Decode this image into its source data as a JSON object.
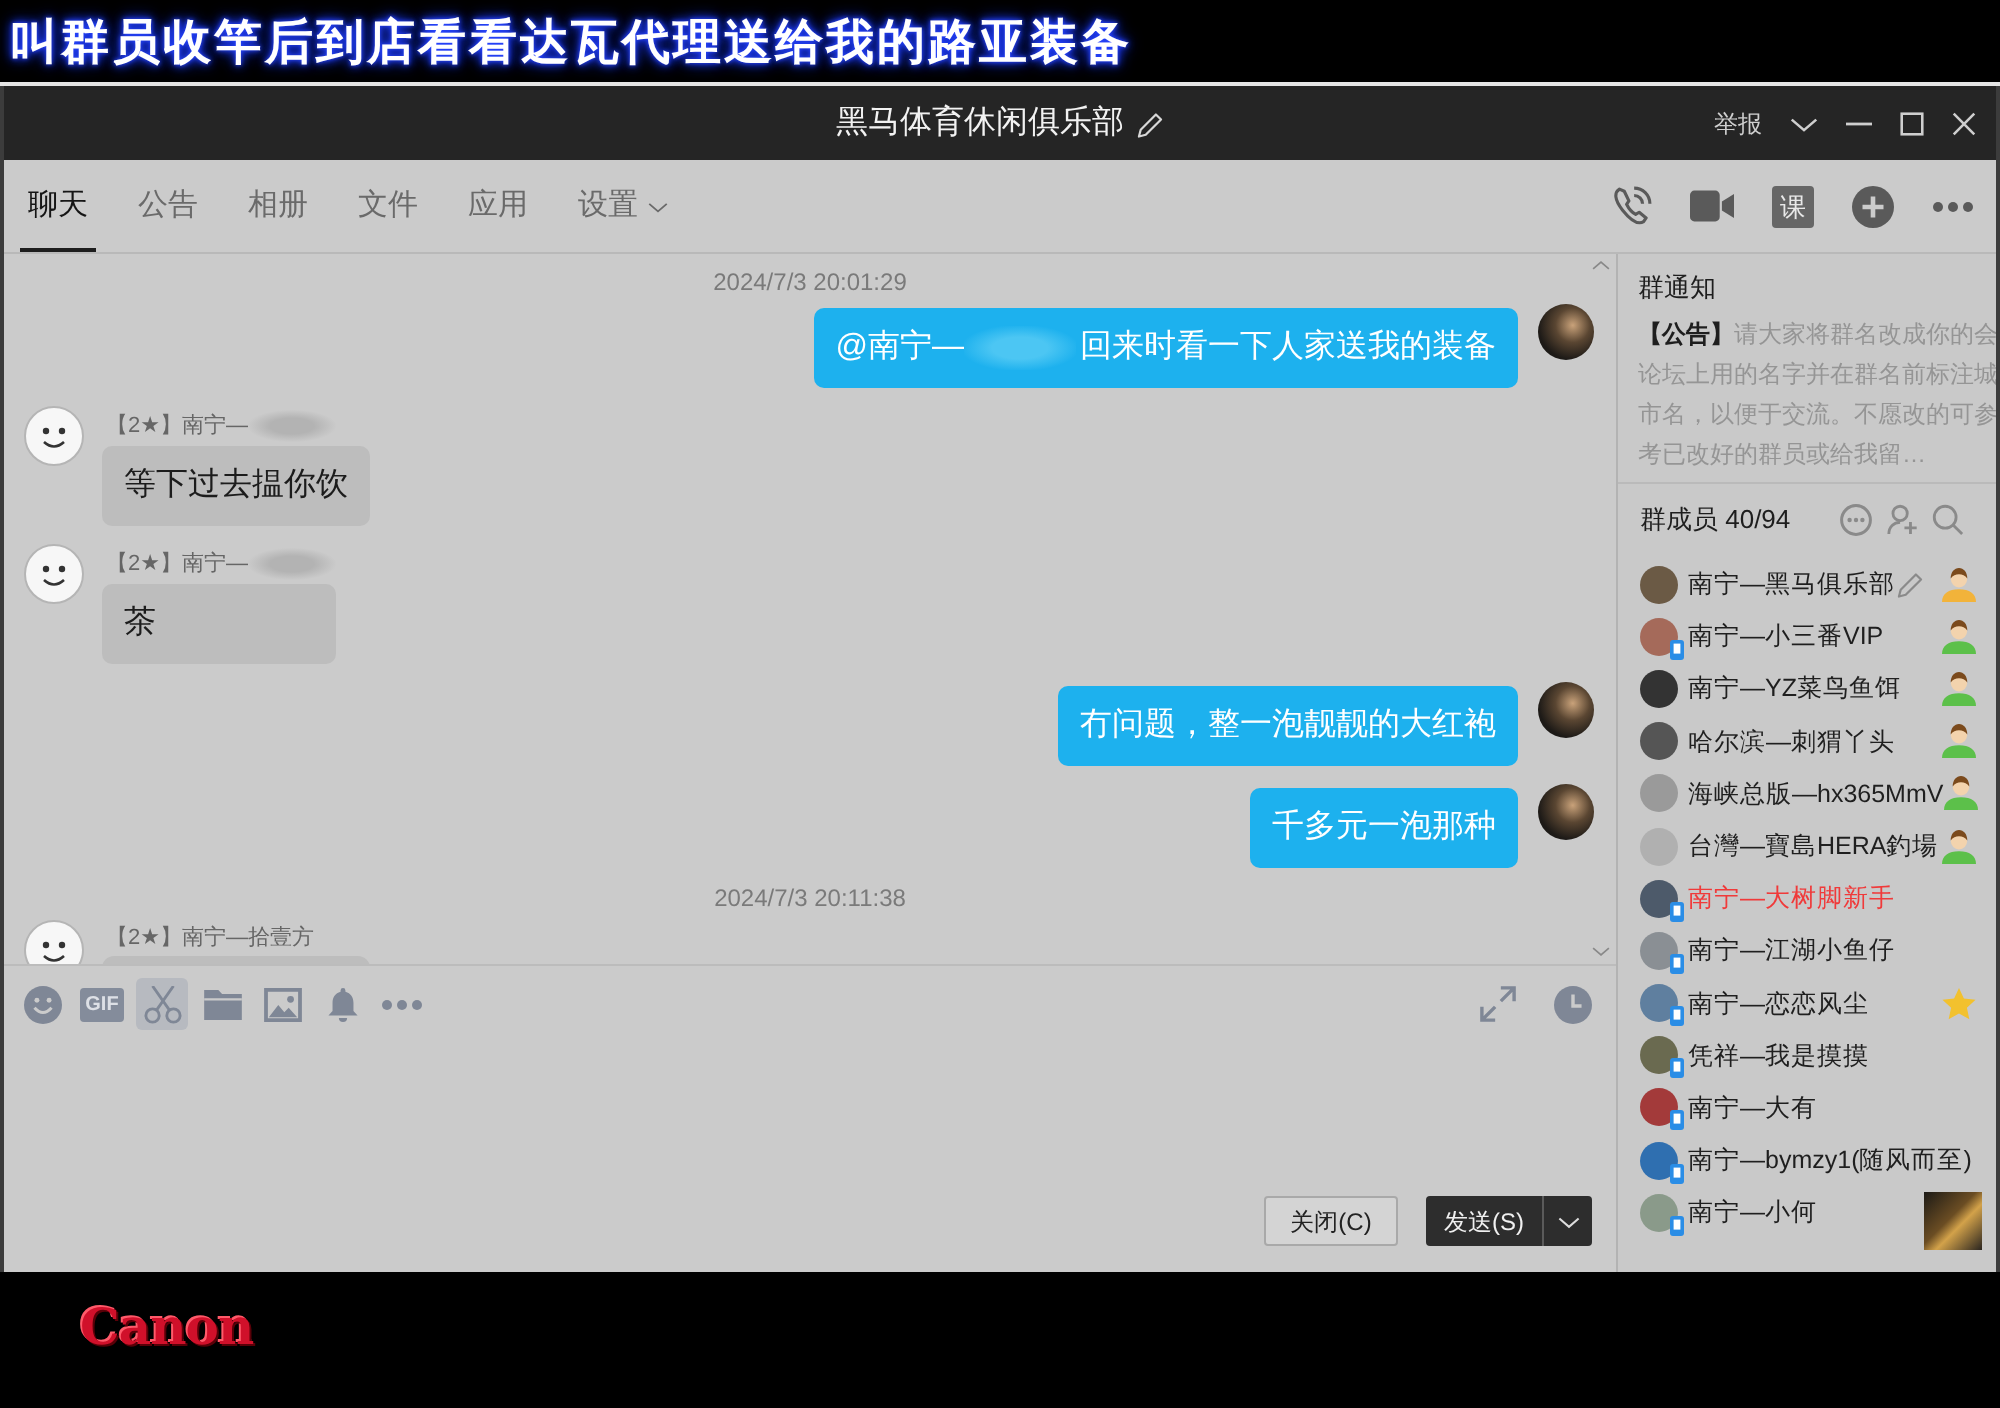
{
  "caption": {
    "text": "叫群员收竿后到店看看达瓦代理送给我的路亚装备"
  },
  "window": {
    "title": "黑马体育休闲俱乐部",
    "report": "举报"
  },
  "tabs": [
    {
      "label": "聊天",
      "kind": "page",
      "selected": true
    },
    {
      "label": "公告",
      "kind": "page",
      "selected": false
    },
    {
      "label": "相册",
      "kind": "page",
      "selected": false
    },
    {
      "label": "文件",
      "kind": "page",
      "selected": false
    },
    {
      "label": "应用",
      "kind": "page",
      "selected": false
    },
    {
      "label": "设置",
      "kind": "menu",
      "selected": false
    }
  ],
  "header_tools": [
    {
      "kind": "voice-call"
    },
    {
      "kind": "video-call"
    },
    {
      "kind": "course",
      "label": "课"
    },
    {
      "kind": "add"
    },
    {
      "kind": "more"
    }
  ],
  "messages": [
    {
      "kind": "time",
      "text": "2024/7/3 20:01:29"
    },
    {
      "kind": "sent",
      "mention": "@南宁—",
      "mention_blurred": true,
      "text": "回来时看一下人家送我的装备"
    },
    {
      "kind": "received",
      "sender": "【2★】南宁—",
      "sender_blurred": true,
      "text": "等下过去揾你饮"
    },
    {
      "kind": "received",
      "sender": "【2★】南宁—",
      "sender_blurred": true,
      "text": "茶"
    },
    {
      "kind": "sent",
      "text": "冇问题，整一泡靓靓的大红袍"
    },
    {
      "kind": "sent",
      "text": "千多元一泡那种"
    },
    {
      "kind": "time",
      "text": "2024/7/3 20:11:38"
    },
    {
      "kind": "received",
      "sender": "【2★】南宁—拾壹方",
      "sender_blurred": false
    }
  ],
  "composer_tools": [
    {
      "kind": "emoji",
      "selected": false
    },
    {
      "kind": "gif",
      "label": "GIF",
      "selected": false
    },
    {
      "kind": "screenshot",
      "selected": true
    },
    {
      "kind": "folder",
      "selected": false
    },
    {
      "kind": "image",
      "selected": false
    },
    {
      "kind": "bell",
      "selected": false
    },
    {
      "kind": "more",
      "selected": false
    }
  ],
  "composer_side_tools": [
    {
      "kind": "expand"
    },
    {
      "kind": "history"
    }
  ],
  "buttons": [
    {
      "kind": "secondary",
      "label": "关闭(C)"
    },
    {
      "kind": "primary",
      "label": "发送(S)"
    }
  ],
  "notice": {
    "title": "群通知",
    "text": "**【公告】**请大家将群名改成你的会论坛上用的名字并在群名前标注城市名，以便于交流。不愿改的可参考已改好的群员或给我留…"
  },
  "members": {
    "title": "群成员 40/94",
    "items": [
      {
        "name": "南宁—黑马俱乐部",
        "kind": "owner",
        "mobile": false,
        "is_self": true,
        "color": "#1f1f1f"
      },
      {
        "name": "南宁—小三番VIP",
        "kind": "admin",
        "mobile": true,
        "is_self": false,
        "color": "#1f1f1f"
      },
      {
        "name": "南宁—YZ菜鸟鱼饵",
        "kind": "admin",
        "mobile": false,
        "is_self": false,
        "color": "#1f1f1f"
      },
      {
        "name": "哈尔滨—刺猬丫头",
        "kind": "admin",
        "mobile": false,
        "is_self": false,
        "color": "#1f1f1f"
      },
      {
        "name": "海峡总版—hx365MmV",
        "kind": "admin",
        "mobile": false,
        "is_self": false,
        "color": "#1f1f1f"
      },
      {
        "name": "台灣—寶島HERA釣場",
        "kind": "admin",
        "mobile": false,
        "is_self": false,
        "color": "#1f1f1f"
      },
      {
        "name": "南宁—大树脚新手",
        "kind": "member",
        "mobile": true,
        "is_self": false,
        "color": "#f03a3a"
      },
      {
        "name": "南宁—江湖小鱼仔",
        "kind": "member",
        "mobile": true,
        "is_self": false,
        "color": "#1f1f1f"
      },
      {
        "name": "南宁—恋恋风尘",
        "kind": "starred",
        "mobile": true,
        "is_self": false,
        "color": "#1f1f1f"
      },
      {
        "name": "凭祥—我是摸摸",
        "kind": "member",
        "mobile": true,
        "is_self": false,
        "color": "#1f1f1f"
      },
      {
        "name": "南宁—大有",
        "kind": "member",
        "mobile": true,
        "is_self": false,
        "color": "#1f1f1f"
      },
      {
        "name": "南宁—bymzy1(随风而至)",
        "kind": "member",
        "mobile": true,
        "is_self": false,
        "color": "#1f1f1f"
      },
      {
        "name": "南宁—小何",
        "kind": "member",
        "mobile": true,
        "is_self": false,
        "color": "#1f1f1f"
      }
    ]
  },
  "logo": {
    "text": "Canon"
  }
}
